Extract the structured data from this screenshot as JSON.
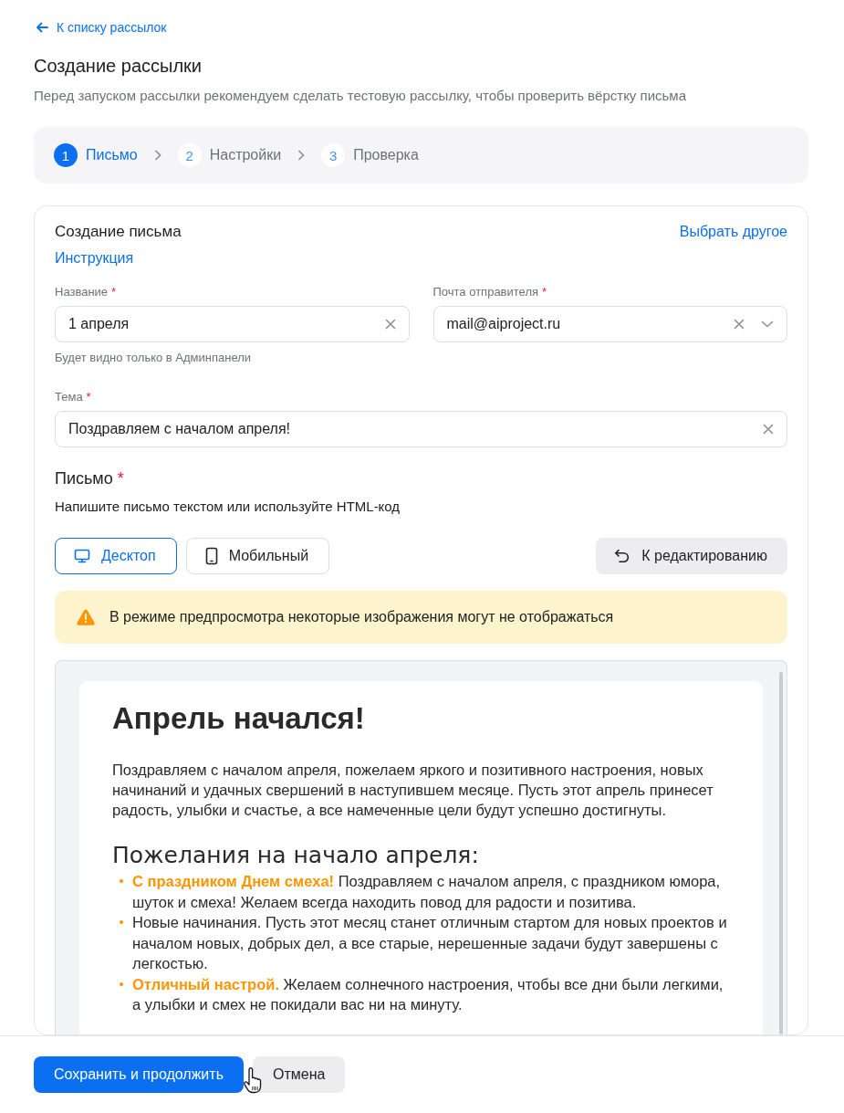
{
  "back_link": "К списку рассылок",
  "title": "Создание рассылки",
  "subtitle": "Перед запуском рассылки рекомендуем сделать тестовую рассылку, чтобы проверить вёрстку письма",
  "steps": [
    {
      "number": "1",
      "label": "Письмо",
      "selected": true
    },
    {
      "number": "2",
      "label": "Настройки",
      "selected": false
    },
    {
      "number": "3",
      "label": "Проверка",
      "selected": false
    }
  ],
  "card": {
    "title": "Создание письма",
    "action_link": "Выбрать другое",
    "instruction_link": "Инструкция",
    "fields": [
      {
        "label": "Название",
        "required_mark": "*",
        "value": "1 апреля",
        "clearable": true,
        "dropdown": false,
        "hint": "Будет видно только в Админпанели"
      },
      {
        "label": "Почта отправителя",
        "required_mark": "*",
        "value": "mail@aiproject.ru",
        "clearable": true,
        "dropdown": true
      }
    ],
    "subject": {
      "label": "Тема",
      "required_mark": "*",
      "value": "Поздравляем с началом апреля!",
      "clearable": true
    },
    "letter": {
      "title": "Письмо",
      "required_mark": "*",
      "description": "Напишите письмо текстом или используйте HTML-код",
      "views": [
        {
          "kind": "desktop",
          "label": "Десктоп",
          "selected": true
        },
        {
          "kind": "mobile",
          "label": "Мобильный",
          "selected": false
        }
      ],
      "edit_button": "К редактированию",
      "warning": "В режиме предпросмотра некоторые изображения могут не отображаться",
      "preview": {
        "heading": "Апрель начался!",
        "paragraph": "Поздравляем с началом апреля, пожелаем яркого и позитивного настроения, новых начинаний и удачных свершений в наступившем месяце. Пусть этот апрель принесет радость, улыбки и счастье, а все намеченные цели будут успешно достигнуты.",
        "subheading": "Пожелания на начало апреля:",
        "items": [
          "**С праздником Днем смеха!** Поздравляем с началом апреля, с праздником юмора, шуток и смеха! Желаем всегда находить повод для радости и позитива.",
          "Новые начинания. Пусть этот месяц станет отличным стартом для новых проектов и началом новых, добрых дел, а все старые, нерешенные задачи будут завершены с легкостью.",
          "**Отличный настрой.** Желаем солнечного настроения, чтобы все дни были легкими, а улыбки и смех не покидали вас ни на минуту."
        ]
      }
    }
  },
  "footer": {
    "primary_button": "Сохранить и продолжить",
    "cancel_button": "Отмена"
  }
}
